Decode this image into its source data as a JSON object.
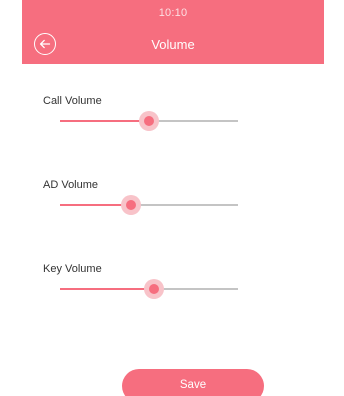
{
  "theme": {
    "accent": "#F66E7F",
    "track": "#C4C4C4",
    "halo": "#F8C3C9"
  },
  "status_bar": {
    "time": "10:10"
  },
  "header": {
    "title": "Volume",
    "back_icon": "arrow-left-circle-icon"
  },
  "settings": [
    {
      "label": "Call Volume",
      "level": 0.5
    },
    {
      "label": "AD Volume",
      "level": 0.4
    },
    {
      "label": "Key Volume",
      "level": 0.53
    }
  ],
  "actions": {
    "save_label": "Save"
  }
}
